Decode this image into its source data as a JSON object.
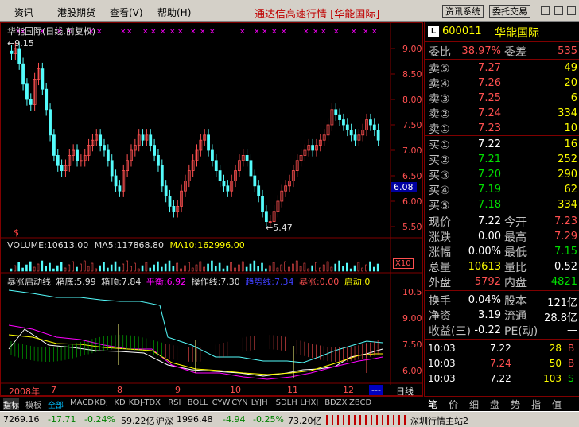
{
  "menu": {
    "items": [
      "资讯",
      "港股期货",
      "查看(V)",
      "帮助(H)"
    ],
    "title": "通达信高速行情 [华能国际]",
    "btn_news": "资讯系统",
    "btn_trade": "委托交易"
  },
  "chart": {
    "title": "华能国际(日线,前复权)",
    "marker_high": "9.15",
    "marker_low": "5.47",
    "price_tag": "6.08",
    "yticks": [
      "9.00",
      "8.50",
      "8.00",
      "7.50",
      "7.00",
      "6.50",
      "6.00",
      "5.50"
    ],
    "dollar": "$",
    "volume_line": {
      "label": "VOLUME:10613.00",
      "ma5": "MA5:117868.80",
      "ma10": "MA10:162996.00",
      "unit": "X10"
    },
    "ind_line": {
      "name": "暴涨启动线",
      "a": "箱底:5.99",
      "b": "箱顶:7.84",
      "c": "平衡:6.92",
      "d": "操作线:7.30",
      "e": "趋势线:7.34",
      "f": "暴涨:0.00",
      "g": "启动:0"
    },
    "ind_ticks": [
      "10.50",
      "9.00",
      "7.50",
      "6.00"
    ],
    "months": [
      "2008年",
      "7",
      "8",
      "9",
      "10",
      "11",
      "12"
    ],
    "period": "日线",
    "colors": {
      "up": "#ff5050",
      "down": "#54fcfc",
      "ma5": "#ffffff",
      "ma10": "#ffff00"
    }
  },
  "chart_data": {
    "type": "candlestick",
    "title": "华能国际(日线,前复权)",
    "ylim": [
      5.3,
      9.3
    ],
    "x": [
      "2008-06",
      "2008-07",
      "2008-08",
      "2008-09",
      "2008-10",
      "2008-11",
      "2008-12"
    ],
    "series": [
      {
        "name": "close",
        "values": [
          9.15,
          7.2,
          6.6,
          6.8,
          5.9,
          6.5,
          7.22
        ]
      }
    ],
    "annotations": {
      "high": 9.15,
      "low": 5.47,
      "last": 6.08
    }
  },
  "quote": {
    "code": "600011",
    "name": "华能国际",
    "code_badge": "L",
    "weibi_label": "委比",
    "weibi": "38.97%",
    "weicha_label": "委差",
    "weicha": "535",
    "sell": [
      {
        "l": "卖⑤",
        "p": "7.27",
        "v": "49"
      },
      {
        "l": "卖④",
        "p": "7.26",
        "v": "20"
      },
      {
        "l": "卖③",
        "p": "7.25",
        "v": "6"
      },
      {
        "l": "卖②",
        "p": "7.24",
        "v": "334"
      },
      {
        "l": "卖①",
        "p": "7.23",
        "v": "10"
      }
    ],
    "buy": [
      {
        "l": "买①",
        "p": "7.22",
        "v": "16"
      },
      {
        "l": "买②",
        "p": "7.21",
        "v": "252"
      },
      {
        "l": "买③",
        "p": "7.20",
        "v": "290"
      },
      {
        "l": "买④",
        "p": "7.19",
        "v": "62"
      },
      {
        "l": "买⑤",
        "p": "7.18",
        "v": "334"
      }
    ],
    "stats": [
      {
        "l1": "现价",
        "v1": "7.22",
        "l2": "今开",
        "v2": "7.23"
      },
      {
        "l1": "涨跌",
        "v1": "0.00",
        "l2": "最高",
        "v2": "7.29"
      },
      {
        "l1": "涨幅",
        "v1": "0.00%",
        "l2": "最低",
        "v2": "7.15"
      },
      {
        "l1": "总量",
        "v1": "10613",
        "l2": "量比",
        "v2": "0.52"
      },
      {
        "l1": "外盘",
        "v1": "5792",
        "l2": "内盘",
        "v2": "4821"
      }
    ],
    "stats2": [
      {
        "l1": "换手",
        "v1": "0.04%",
        "l2": "股本",
        "v2": "121亿"
      },
      {
        "l1": "净资",
        "v1": "3.19",
        "l2": "流通",
        "v2": "28.8亿"
      },
      {
        "l1": "收益(三)",
        "v1": "-0.22",
        "l2": "PE(动)",
        "v2": "—"
      }
    ],
    "ticks": [
      {
        "t": "10:03",
        "p": "7.22",
        "v": "28",
        "d": "B"
      },
      {
        "t": "10:03",
        "p": "7.24",
        "v": "50",
        "d": "B"
      },
      {
        "t": "10:03",
        "p": "7.22",
        "v": "103",
        "d": "S"
      }
    ]
  },
  "tabs": {
    "bottom": [
      "指标",
      "模板",
      "全部",
      "MACD",
      "KDJ",
      "KD",
      "KDJ-TDX",
      "RSI",
      "BOLL",
      "CYW",
      "CYN",
      "LYJH",
      "SDLH",
      "LHXJ",
      "BDZX",
      "ZBCD"
    ],
    "right": [
      "笔",
      "价",
      "细",
      "盘",
      "势",
      "指",
      "值"
    ]
  },
  "status": {
    "idx1": "7269.16",
    "chg1": "-17.71",
    "pct1": "-0.24%",
    "amt1": "59.22亿",
    "name2": "沪深",
    "idx2": "1996.48",
    "chg2": "-4.94",
    "pct2": "-0.25%",
    "amt2": "73.20亿",
    "server": "深圳行情主站2"
  }
}
